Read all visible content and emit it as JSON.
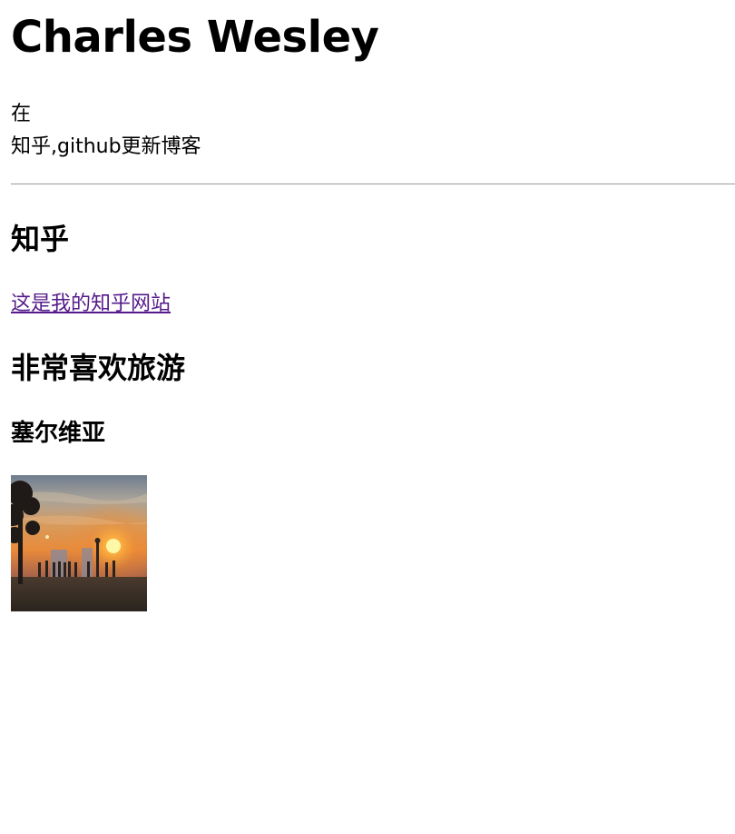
{
  "page": {
    "title": "Charles Wesley",
    "intro_line1": "在",
    "intro_line2": "知乎,github更新博客"
  },
  "zhihu": {
    "heading": "知乎",
    "link_text": "这是我的知乎网站"
  },
  "travel": {
    "heading": "非常喜欢旅游",
    "subheading": "塞尔维亚",
    "photo_icon": "sunset-photo"
  },
  "colors": {
    "link_visited": "#551a8b",
    "divider": "#999999"
  }
}
